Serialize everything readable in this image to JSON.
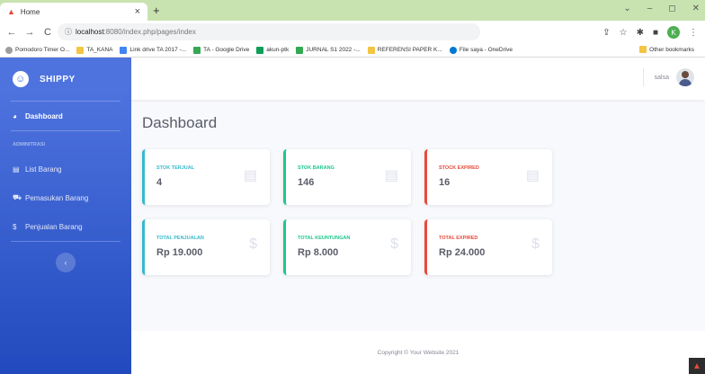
{
  "browser": {
    "tab_title": "Home",
    "tab_close": "×",
    "new_tab": "+",
    "window_controls": [
      "⌄",
      "–",
      "◻",
      "✕"
    ],
    "url_host": "localhost",
    "url_path": ":8080/index.php/pages/index",
    "profile_initial": "K",
    "bookmarks": [
      {
        "label": "Pomodoro Timer O...",
        "color": "#9e9e9e"
      },
      {
        "label": "TA_KANA",
        "color": "#f4c542"
      },
      {
        "label": "Link drive TA 2017 -...",
        "color": "#4285f4"
      },
      {
        "label": "TA - Google Drive",
        "color": "#34a853"
      },
      {
        "label": "akun-ptk",
        "color": "#0f9d58"
      },
      {
        "label": "JURNAL S1 2022 -...",
        "color": "#34a853"
      },
      {
        "label": "REFERENSI PAPER K...",
        "color": "#f4c542"
      },
      {
        "label": "File saya - OneDrive",
        "color": "#0078d4"
      }
    ],
    "other_bookmarks": "Other bookmarks"
  },
  "sidebar": {
    "brand": "SHIPPY",
    "dashboard": "Dashboard",
    "heading": "ADMINITRASI",
    "items": [
      {
        "label": "List Barang",
        "icon": "clipboard-icon"
      },
      {
        "label": "Pemasukan Barang",
        "icon": "truck-icon"
      },
      {
        "label": "Penjualan Barang",
        "icon": "dollar-icon"
      }
    ],
    "toggle": "‹"
  },
  "topbar": {
    "username": "salsa"
  },
  "main": {
    "title": "Dashboard",
    "cards": [
      {
        "label": "STOK TERJUAL",
        "value": "4",
        "icon": "clipboard-icon"
      },
      {
        "label": "STOK BARANG",
        "value": "146",
        "icon": "clipboard-icon"
      },
      {
        "label": "STOCK EXPIRED",
        "value": "16",
        "icon": "clipboard-icon"
      },
      {
        "label": "TOTAL PENJUALAN",
        "value": "Rp 19.000",
        "icon": "dollar-icon"
      },
      {
        "label": "TOTAL KEUNTUNGAN",
        "value": "Rp 8.000",
        "icon": "dollar-icon"
      },
      {
        "label": "TOTAL EXPIRED",
        "value": "Rp 24.000",
        "icon": "dollar-icon"
      }
    ]
  },
  "footer": {
    "copyright": "Copyright © Your Website 2021"
  },
  "colors": {
    "primary": "#4e73df",
    "info": "#36b9cc",
    "success": "#1cc88a",
    "danger": "#e74a3b"
  }
}
